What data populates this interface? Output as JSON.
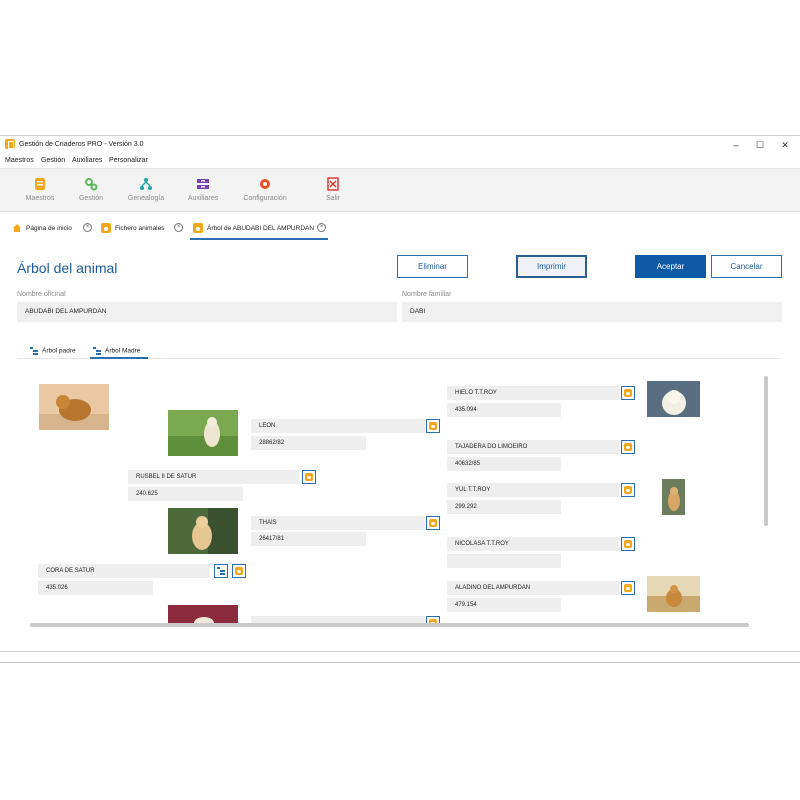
{
  "window": {
    "title": "Gestión de Criaderos PRO  - Versión 3.0",
    "controls": {
      "minimize": "–",
      "maximize": "☐",
      "close": "✕"
    }
  },
  "menu": [
    "Maestros",
    "Gestión",
    "Auxiliares",
    "Personalizar"
  ],
  "ribbon": [
    {
      "label": "Maestros",
      "icon": "maestros-icon",
      "color": "#f2a71c"
    },
    {
      "label": "Gestión",
      "icon": "gears-icon",
      "color": "#5cb85c"
    },
    {
      "label": "Genealogía",
      "icon": "tree-icon",
      "color": "#1fa3a3"
    },
    {
      "label": "Auxiliares",
      "icon": "auxiliares-icon",
      "color": "#7b3fb8"
    },
    {
      "label": "Configuración",
      "icon": "gear-icon",
      "color": "#e8501e"
    },
    {
      "label": "Salir",
      "icon": "exit-icon",
      "color": "#d9302c"
    }
  ],
  "tabs": [
    {
      "label": "Página de inicio",
      "icon": "home-icon"
    },
    {
      "label": "Fichero animales",
      "icon": "paw-icon"
    },
    {
      "label": "Árbol de ABUDABI DEL AMPURDAN",
      "icon": "paw-icon"
    }
  ],
  "page": {
    "title": "Árbol del animal",
    "buttons": {
      "delete": "Eliminar",
      "print": "Imprimir",
      "accept": "Aceptar",
      "cancel": "Cancelar"
    },
    "official_name_label": "Nombre oficinal",
    "official_name": "ABUDABI DEL AMPURDAN",
    "family_name_label": "Nombre familiar",
    "family_name": "DABI"
  },
  "subtabs": {
    "father": "Árbol padre",
    "mother": "Árbol Madre"
  },
  "tree": {
    "mother": {
      "name": "RUSBEL II DE SATUR",
      "reg": "240.625"
    },
    "cora": {
      "name": "CORA DE SATUR",
      "reg": "435.026"
    },
    "leon": {
      "name": "LEON",
      "reg": "28862/82"
    },
    "thais": {
      "name": "THAIS",
      "reg": "26417/81"
    },
    "hielo": {
      "name": "HIELO T.T.ROY",
      "reg": "435.094"
    },
    "tajadera": {
      "name": "TAJADERA DO LIMOEIRO",
      "reg": "40632/85"
    },
    "yul": {
      "name": "YUL T.T.ROY",
      "reg": "299.292"
    },
    "nicolasa": {
      "name": "NICOLASA T.T.ROY",
      "reg": ""
    },
    "aladino": {
      "name": "ALADINO DEL AMPURDAN",
      "reg": "479.154"
    }
  },
  "colors": {
    "accent": "#0e5aa7",
    "title": "#1d5c9c",
    "paw": "#f2a71c"
  }
}
